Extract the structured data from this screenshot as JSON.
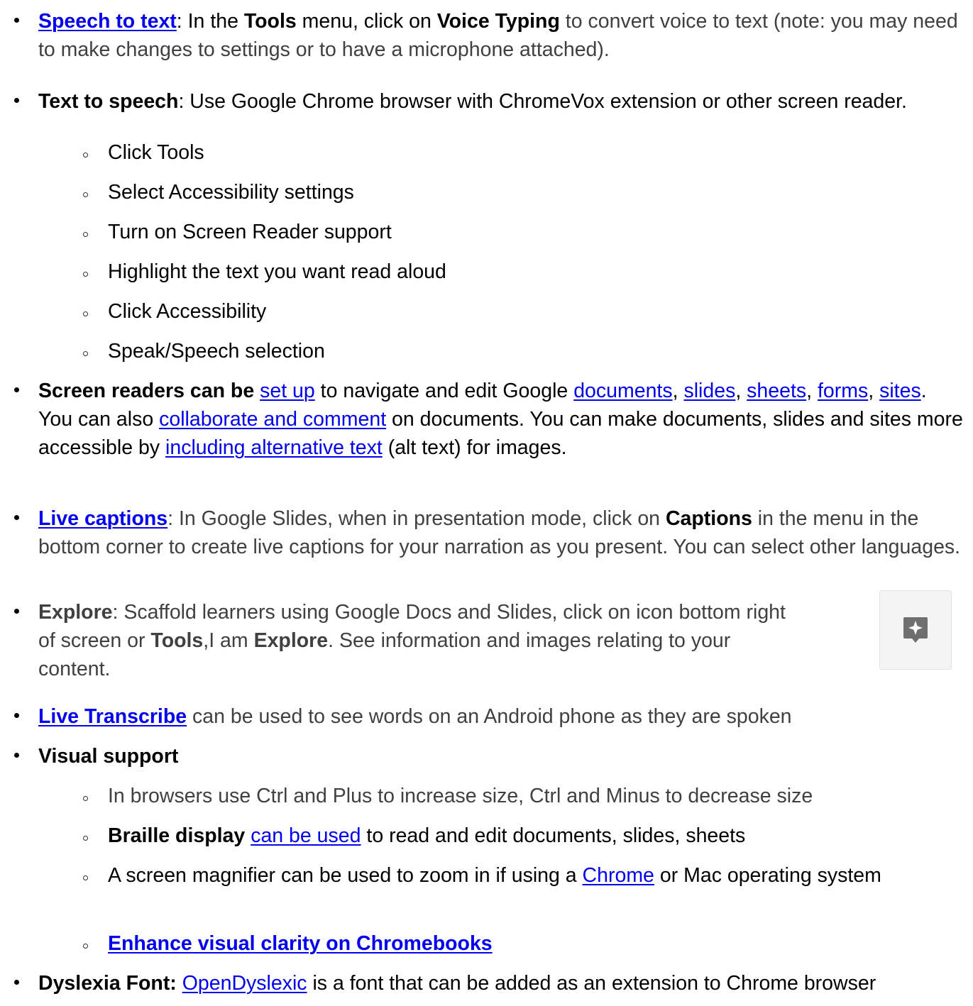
{
  "items": {
    "speech": {
      "link": "Speech to text",
      "t1": ": In the ",
      "b1": "Tools",
      "t2": " menu, click on ",
      "b2": "Voice Typing",
      "t3": " to convert voice to text (note: you may need to make changes to settings or to have a microphone attached)."
    },
    "tts": {
      "title": "Text to speech",
      "text": ": Use Google Chrome browser with ChromeVox extension or other screen reader.",
      "steps": [
        "Click Tools",
        "Select Accessibility settings",
        "Turn on Screen Reader support",
        "Highlight the text you want read aloud",
        "Click Accessibility",
        "Speak/Speech selection"
      ]
    },
    "screen_readers": {
      "title": "Screen readers can be",
      "link_setup": "set up",
      "t1": " to navigate and edit Google ",
      "link_documents": "documents",
      "c1": ", ",
      "link_slides": "slides",
      "c2": ", ",
      "link_sheets": "sheets",
      "c3": ", ",
      "link_forms": "forms",
      "c4": ", ",
      "link_sites": "sites",
      "t2": ".  You can also ",
      "link_collab": "collaborate and comment",
      "t3": " on documents.  You can make documents, slides and sites more accessible by ",
      "link_alt": "including alternative text",
      "t4": " (alt text) for images."
    },
    "captions": {
      "link": "Live captions",
      "t1": ": In Google Slides, when in presentation mode, click on ",
      "b1": "Captions",
      "t2": " in the menu in the bottom corner to create live captions for your narration as you present. You can select other languages."
    },
    "explore": {
      "title": "Explore",
      "t1": ": Scaffold learners using Google Docs and Slides, click on icon bottom right of screen or ",
      "b1": "Tools",
      "t2": ",I am ",
      "b2": "Explore",
      "t3": ". See information and images relating to your content.",
      "icon": "explore-icon",
      "icon_color": "#6f6f6f"
    },
    "transcribe": {
      "link": "Live Transcribe",
      "text": " can be used to see words on an Android phone as they are spoken"
    },
    "visual": {
      "title": "Visual support",
      "sub1": "In browsers use Ctrl and Plus to increase size, Ctrl and Minus to decrease size",
      "sub2_bold": "Braille display",
      "sub2_link": "can be used",
      "sub2_text": " to read and edit documents, slides, sheets",
      "sub3_a": " A screen magnifier can be used to zoom in if using a ",
      "sub3_link": "Chrome",
      "sub3_b": " or Mac operating system",
      "sub4_link": "Enhance visual clarity on Chromebooks"
    },
    "dyslexia": {
      "title": "Dyslexia Font:",
      "link": "OpenDyslexic",
      "text": " is a font that can be added as an extension to Chrome browser"
    }
  },
  "colors": {
    "link": "#0000ee",
    "text": "#000000",
    "grey_text": "#404040"
  }
}
